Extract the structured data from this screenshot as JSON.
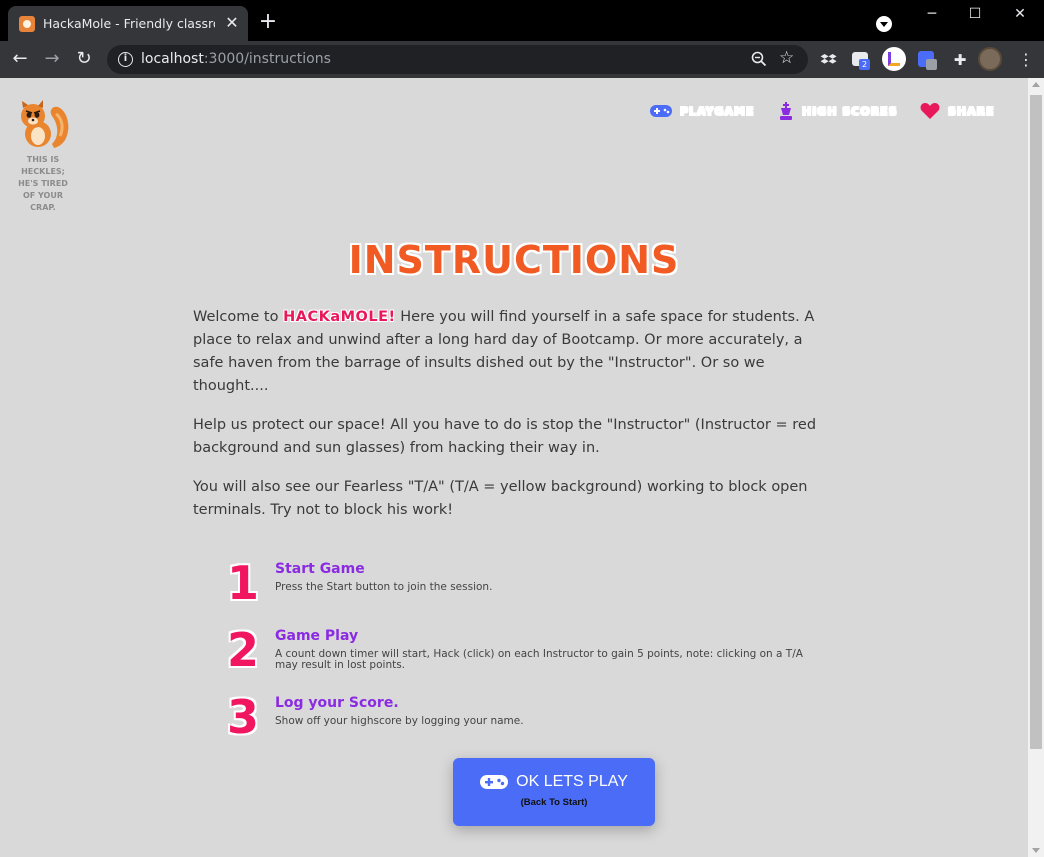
{
  "browser": {
    "tab_title": "HackaMole - Friendly classroom g",
    "url_host": "localhost",
    "url_path": ":3000/instructions",
    "extension_badge": "2"
  },
  "mascot": {
    "caption": "THIS IS HECKLES; HE'S TIRED OF YOUR CRAP."
  },
  "nav": {
    "play": "PLAYGAME",
    "scores": "HIGH SCORES",
    "share": "SHARE"
  },
  "title": "INSTRUCTIONS",
  "intro": {
    "lead": "Welcome to ",
    "brand": "HACKaMOLE!",
    "rest": " Here you will find yourself in a safe space for students. A place to relax and unwind after a long hard day of Bootcamp. Or more accurately, a safe haven from the barrage of insults dished out by the \"Instructor\". Or so we thought...."
  },
  "para2": "Help us protect our space! All you have to do is stop the \"Instructor\" (Instructor = red background and sun glasses) from hacking their way in.",
  "para3": "You will also see our Fearless \"T/A\" (T/A = yellow background) working to block open terminals. Try not to block his work!",
  "steps": [
    {
      "num": "1",
      "title": "Start Game",
      "desc": "Press the Start button to join the session."
    },
    {
      "num": "2",
      "title": "Game Play",
      "desc": "A count down timer will start, Hack (click) on each Instructor to gain 5 points, note: clicking on a T/A may result in lost points."
    },
    {
      "num": "3",
      "title": "Log your Score.",
      "desc": "Show off your highscore by logging your name."
    }
  ],
  "cta": {
    "label": "OK LETS PLAY",
    "sub": "(Back To Start)"
  },
  "colors": {
    "title": "#f15a22",
    "brand": "#e8195b",
    "step_num": "#f0165f",
    "step_title": "#8a2be2",
    "nav_play": "#4a6cf7",
    "nav_scores": "#8a2be2",
    "nav_share": "#e8195b",
    "button": "#4a6cf7"
  }
}
